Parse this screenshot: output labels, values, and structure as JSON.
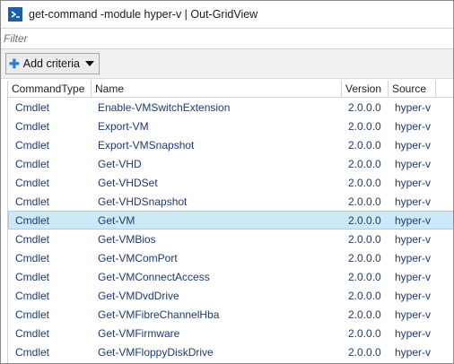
{
  "window": {
    "title": "get-command -module hyper-v | Out-GridView",
    "icon": "powershell-icon"
  },
  "filter": {
    "placeholder": "Filter",
    "value": ""
  },
  "criteria": {
    "button_label": "Add criteria"
  },
  "grid": {
    "columns": [
      "CommandType",
      "Name",
      "Version",
      "Source"
    ],
    "selected_index": 6,
    "rows": [
      [
        "Cmdlet",
        "Enable-VMSwitchExtension",
        "2.0.0.0",
        "hyper-v"
      ],
      [
        "Cmdlet",
        "Export-VM",
        "2.0.0.0",
        "hyper-v"
      ],
      [
        "Cmdlet",
        "Export-VMSnapshot",
        "2.0.0.0",
        "hyper-v"
      ],
      [
        "Cmdlet",
        "Get-VHD",
        "2.0.0.0",
        "hyper-v"
      ],
      [
        "Cmdlet",
        "Get-VHDSet",
        "2.0.0.0",
        "hyper-v"
      ],
      [
        "Cmdlet",
        "Get-VHDSnapshot",
        "2.0.0.0",
        "hyper-v"
      ],
      [
        "Cmdlet",
        "Get-VM",
        "2.0.0.0",
        "hyper-v"
      ],
      [
        "Cmdlet",
        "Get-VMBios",
        "2.0.0.0",
        "hyper-v"
      ],
      [
        "Cmdlet",
        "Get-VMComPort",
        "2.0.0.0",
        "hyper-v"
      ],
      [
        "Cmdlet",
        "Get-VMConnectAccess",
        "2.0.0.0",
        "hyper-v"
      ],
      [
        "Cmdlet",
        "Get-VMDvdDrive",
        "2.0.0.0",
        "hyper-v"
      ],
      [
        "Cmdlet",
        "Get-VMFibreChannelHba",
        "2.0.0.0",
        "hyper-v"
      ],
      [
        "Cmdlet",
        "Get-VMFirmware",
        "2.0.0.0",
        "hyper-v"
      ],
      [
        "Cmdlet",
        "Get-VMFloppyDiskDrive",
        "2.0.0.0",
        "hyper-v"
      ]
    ]
  },
  "colors": {
    "selection": "#cde8f7",
    "cell_text": "#1e3a6e",
    "powershell_blue": "#1b5fa8"
  }
}
